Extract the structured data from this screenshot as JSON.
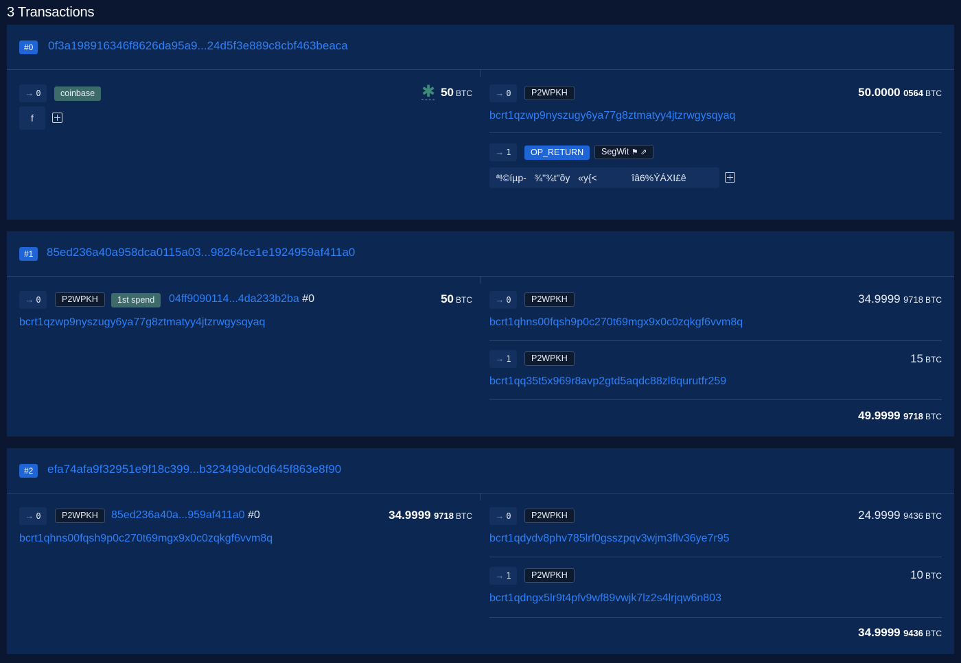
{
  "heading": "3 Transactions",
  "transactions": [
    {
      "num": "#0",
      "txid": "0f3a198916346f8626da95a9...24d5f3e889c8cbf463beaca",
      "inputs": [
        {
          "index": "0",
          "badges": [
            "coinbase"
          ],
          "value_main": "50",
          "unit": "BTC",
          "scriptsig": "f"
        }
      ],
      "outputs": [
        {
          "index": "0",
          "type": "P2WPKH",
          "address": "bcrt1qzwp9nyszugy6ya77g8ztmatyy4jtzrwgysqyaq",
          "value_main": "50.0000",
          "value_sub": "0564",
          "unit": "BTC"
        },
        {
          "index": "1",
          "type": "OP_RETURN",
          "tag": "SegWit",
          "data": "ª!©íµp-   ¾\"¾t\"õy   «y{<             îâ6%ÝÁXI£ê"
        }
      ]
    },
    {
      "num": "#1",
      "txid": "85ed236a40a958dca0115a03...98264ce1e1924959af411a0",
      "inputs": [
        {
          "index": "0",
          "type": "P2WPKH",
          "badge": "1st spend",
          "prevout": "04ff9090114...4da233b2ba",
          "prevout_idx": "#0",
          "address": "bcrt1qzwp9nyszugy6ya77g8ztmatyy4jtzrwgysqyaq",
          "value_main": "50",
          "unit": "BTC"
        }
      ],
      "outputs": [
        {
          "index": "0",
          "type": "P2WPKH",
          "address": "bcrt1qhns00fqsh9p0c270t69mgx9x0c0zqkgf6vvm8q",
          "value_main": "34.9999",
          "value_sub": "9718",
          "unit": "BTC"
        },
        {
          "index": "1",
          "type": "P2WPKH",
          "address": "bcrt1qq35t5x969r8avp2gtd5aqdc88zl8qurutfr259",
          "value_main": "15",
          "unit": "BTC"
        }
      ],
      "total_main": "49.9999",
      "total_sub": "9718",
      "total_unit": "BTC"
    },
    {
      "num": "#2",
      "txid": "efa74afa9f32951e9f18c399...b323499dc0d645f863e8f90",
      "inputs": [
        {
          "index": "0",
          "type": "P2WPKH",
          "prevout": "85ed236a40a...959af411a0",
          "prevout_idx": "#0",
          "address": "bcrt1qhns00fqsh9p0c270t69mgx9x0c0zqkgf6vvm8q",
          "value_main": "34.9999",
          "value_sub": "9718",
          "unit": "BTC"
        }
      ],
      "outputs": [
        {
          "index": "0",
          "type": "P2WPKH",
          "address": "bcrt1qdydv8phv785lrf0gsszpqv3wjm3flv36ye7r95",
          "value_main": "24.9999",
          "value_sub": "9436",
          "unit": "BTC"
        },
        {
          "index": "1",
          "type": "P2WPKH",
          "address": "bcrt1qdngx5lr9t4pfv9wf89vwjk7lz2s4lrjqw6n803",
          "value_main": "10",
          "unit": "BTC"
        }
      ],
      "total_main": "34.9999",
      "total_sub": "9436",
      "total_unit": "BTC"
    }
  ]
}
